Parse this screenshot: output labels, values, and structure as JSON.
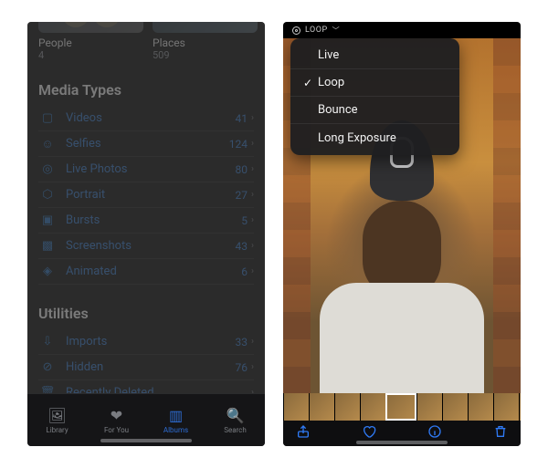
{
  "left": {
    "people_places": {
      "people": {
        "label": "People",
        "count": "4"
      },
      "places": {
        "label": "Places",
        "count": "509"
      }
    },
    "media_types": {
      "header": "Media Types",
      "items": [
        {
          "icon": "videocam-icon",
          "label": "Videos",
          "count": "41"
        },
        {
          "icon": "selfie-icon",
          "label": "Selfies",
          "count": "124"
        },
        {
          "icon": "livephoto-icon",
          "label": "Live Photos",
          "count": "80"
        },
        {
          "icon": "portrait-icon",
          "label": "Portrait",
          "count": "27"
        },
        {
          "icon": "burst-icon",
          "label": "Bursts",
          "count": "5"
        },
        {
          "icon": "screenshot-icon",
          "label": "Screenshots",
          "count": "43"
        },
        {
          "icon": "animated-icon",
          "label": "Animated",
          "count": "6"
        }
      ]
    },
    "utilities": {
      "header": "Utilities",
      "items": [
        {
          "icon": "import-icon",
          "label": "Imports",
          "count": "33"
        },
        {
          "icon": "hidden-icon",
          "label": "Hidden",
          "count": "76"
        },
        {
          "icon": "trash-icon",
          "label": "Recently Deleted",
          "count": ""
        }
      ]
    },
    "tabs": {
      "library": "Library",
      "foryou": "For You",
      "albums": "Albums",
      "search": "Search",
      "active": "albums"
    }
  },
  "right": {
    "badge": "LOOP",
    "dropdown": [
      {
        "label": "Live",
        "selected": false
      },
      {
        "label": "Loop",
        "selected": true
      },
      {
        "label": "Bounce",
        "selected": false
      },
      {
        "label": "Long Exposure",
        "selected": false
      }
    ],
    "actions": {
      "share": "share-icon",
      "favorite": "heart-icon",
      "info": "info-icon",
      "delete": "trash-icon"
    }
  }
}
